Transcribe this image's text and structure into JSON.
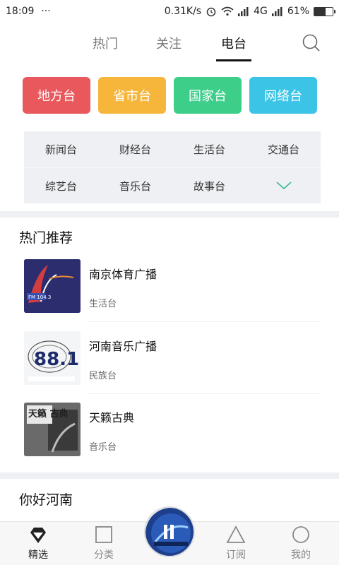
{
  "status_bar": {
    "time": "18:09",
    "dots": "···",
    "speed": "0.31K/s",
    "network": "4G",
    "battery_percent": "61%",
    "battery_level": 0.61
  },
  "header": {
    "tabs": [
      {
        "label": "热门"
      },
      {
        "label": "关注"
      },
      {
        "label": "电台"
      }
    ],
    "active_tab": "电台"
  },
  "categories": [
    {
      "label": "地方台",
      "color": "#e8585c"
    },
    {
      "label": "省市台",
      "color": "#f6b63c"
    },
    {
      "label": "国家台",
      "color": "#3dce8a"
    },
    {
      "label": "网络台",
      "color": "#3cc4e6"
    }
  ],
  "sub_categories": {
    "row1": [
      "新闻台",
      "财经台",
      "生活台",
      "交通台"
    ],
    "row2": [
      "综艺台",
      "音乐台",
      "故事台"
    ]
  },
  "hot_section": {
    "title": "热门推荐",
    "items": [
      {
        "name": "南京体育广播",
        "tag": "生活台",
        "thumb_text": "FM 104.3"
      },
      {
        "name": "河南音乐广播",
        "tag": "民族台",
        "thumb_text": "88.1"
      },
      {
        "name": "天籁古典",
        "tag": "音乐台",
        "thumb_text": "天籁 古典"
      }
    ]
  },
  "second_section": {
    "title": "你好河南"
  },
  "bottom_nav": {
    "items": [
      {
        "label": "精选"
      },
      {
        "label": "分类"
      },
      {
        "label": "订阅"
      },
      {
        "label": "我的"
      }
    ]
  }
}
